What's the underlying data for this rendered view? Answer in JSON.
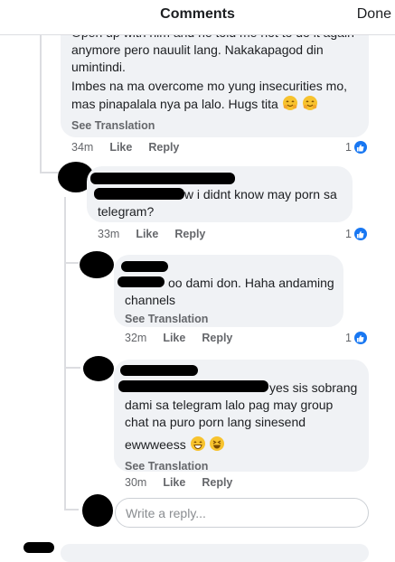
{
  "header": {
    "title": "Comments",
    "done_label": "Done"
  },
  "comments": [
    {
      "lines": [
        "Open up with him and he told me not to do it again",
        "anymore pero nauulit lang. Nakakapagod din",
        "umintindi.",
        "Imbes na ma overcome mo yung insecurities mo,",
        "mas pinapalala nya pa lalo. Hugs tita"
      ],
      "see_translation": "See Translation",
      "time": "34m",
      "like": "Like",
      "reply": "Reply",
      "reactions": "1"
    },
    {
      "lines": [
        "wow i didnt know may porn sa",
        "telegram?"
      ],
      "time": "33m",
      "like": "Like",
      "reply": "Reply",
      "reactions": "1"
    },
    {
      "lines": [
        "oo dami don. Haha andaming",
        "channels"
      ],
      "see_translation": "See Translation",
      "time": "32m",
      "like": "Like",
      "reply": "Reply",
      "reactions": "1"
    },
    {
      "lines": [
        "yes sis sobrang",
        "dami sa telegram lalo pag may group",
        "chat na puro porn lang sinesend",
        "ewwweess"
      ],
      "see_translation": "See Translation",
      "time": "30m",
      "like": "Like",
      "reply": "Reply"
    }
  ],
  "reply_box": {
    "placeholder": "Write a reply..."
  },
  "colors": {
    "accent": "#1877f2",
    "bubble": "#f0f2f5",
    "muted": "#65676b"
  },
  "icons": [
    "like-thumb-icon",
    "hugging-face-emoji",
    "grinning-emoji",
    "laughing-emoji"
  ]
}
